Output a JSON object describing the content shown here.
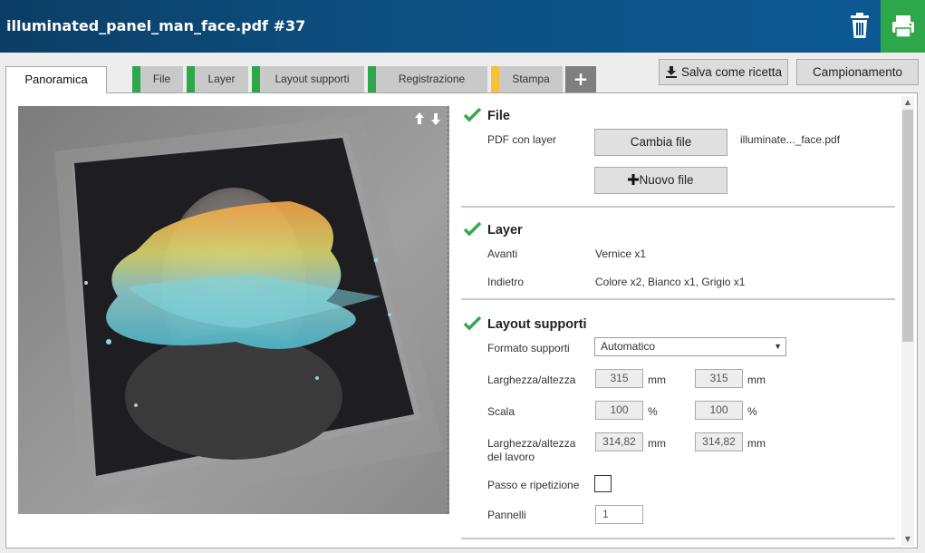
{
  "window": {
    "title": "illuminated_panel_man_face.pdf #37"
  },
  "titlebar_icons": {
    "delete": "trash-icon",
    "print": "printer-icon"
  },
  "colors": {
    "titlebar": "#0c4d7e",
    "print_button": "#2ea74a",
    "ok_green": "#38a850",
    "warn_yellow": "#f5c333"
  },
  "tabs": [
    {
      "label": "Panoramica",
      "status": "active"
    },
    {
      "label": "File",
      "status_color": "#2ea74a"
    },
    {
      "label": "Layer",
      "status_color": "#2ea74a"
    },
    {
      "label": "Layout supporti",
      "status_color": "#2ea74a"
    },
    {
      "label": "Registrazione",
      "status_color": "#2ea74a"
    },
    {
      "label": "Stampa",
      "status_color": "#f5c333"
    }
  ],
  "add_tab": {
    "label": "+"
  },
  "toolbar": {
    "save_recipe": "Salva come ricetta",
    "sampling": "Campionamento"
  },
  "sections": {
    "file": {
      "title": "File",
      "pdf_label": "PDF con layer",
      "change_button": "Cambia file",
      "new_button": "Nuovo file",
      "filename": "illuminate..._face.pdf"
    },
    "layer": {
      "title": "Layer",
      "front_label": "Avanti",
      "front_value": "Vernice x1",
      "back_label": "Indietro",
      "back_value": "Colore x2, Bianco x1, Grigio x1"
    },
    "layout": {
      "title": "Layout supporti",
      "format_label": "Formato supporti",
      "format_value": "Automatico",
      "size_label": "Larghezza/altezza",
      "width": "315",
      "height": "315",
      "size_unit": "mm",
      "scale_label": "Scala",
      "scale_w": "100",
      "scale_h": "100",
      "scale_unit": "%",
      "job_size_label_1": "Larghezza/altezza",
      "job_size_label_2": "del lavoro",
      "job_width": "314,82",
      "job_height": "314,82",
      "job_unit": "mm",
      "step_repeat_label": "Passo e ripetizione",
      "step_repeat_checked": false,
      "panels_label": "Pannelli",
      "panels_value": "1"
    }
  }
}
